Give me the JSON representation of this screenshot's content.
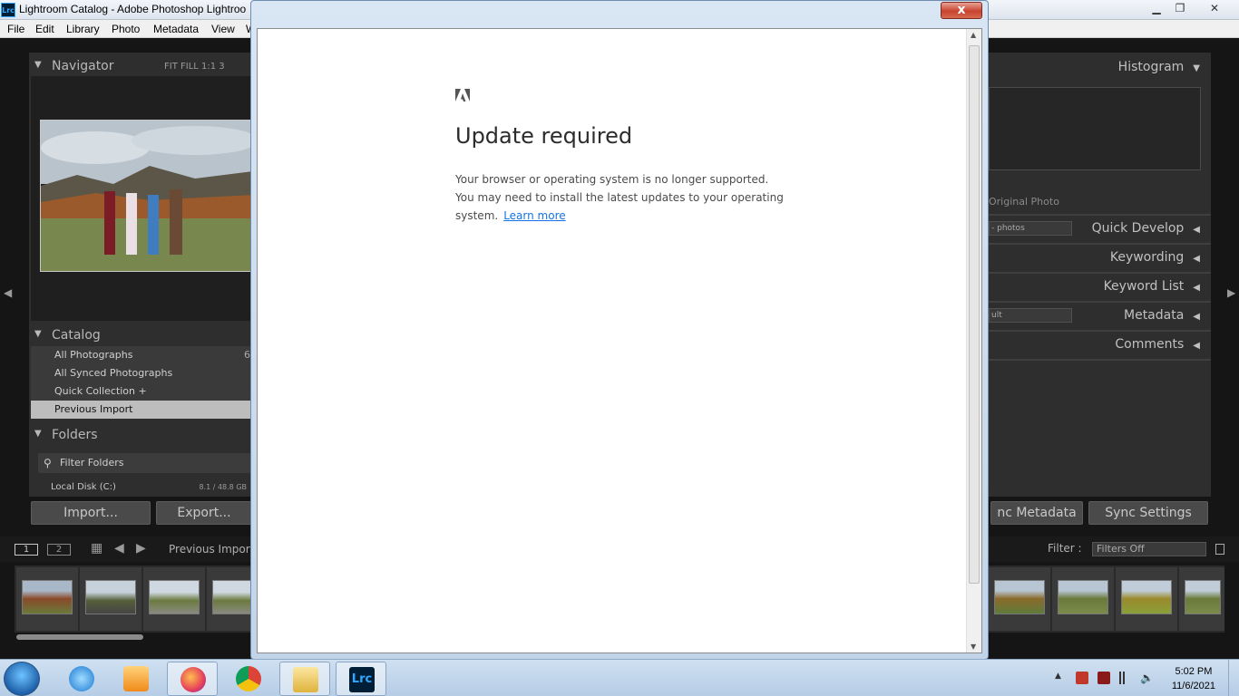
{
  "window": {
    "app_icon": "Lrc",
    "title": "Lightroom Catalog - Adobe Photoshop Lightroo",
    "minimize_icon": "minimize-icon",
    "maximize_icon": "maximize-icon",
    "close_icon": "close-icon"
  },
  "menu": [
    "File",
    "Edit",
    "Library",
    "Photo",
    "Metadata",
    "View",
    "W"
  ],
  "navigator": {
    "title": "Navigator",
    "modes": "FIT   FILL   1:1   3"
  },
  "catalog": {
    "title": "Catalog",
    "items": [
      {
        "label": "All Photographs",
        "count": "6",
        "selected": false
      },
      {
        "label": "All Synced Photographs",
        "count": "",
        "selected": false
      },
      {
        "label": "Quick Collection  +",
        "count": "",
        "selected": false
      },
      {
        "label": "Previous Import",
        "count": "",
        "selected": true
      }
    ]
  },
  "folders": {
    "title": "Folders",
    "filter_placeholder": "Filter Folders",
    "disk_label": "Local Disk (C:)",
    "disk_size": "8.1 / 48.8 GB"
  },
  "left_buttons": {
    "import": "Import...",
    "export": "Export..."
  },
  "right_panel": {
    "histogram": "Histogram",
    "original_photo": "Original Photo",
    "quick_develop_select": "- photos",
    "quick_develop": "Quick Develop",
    "keywording": "Keywording",
    "keyword_list": "Keyword List",
    "metadata_select": "ult",
    "metadata": "Metadata",
    "comments": "Comments",
    "sync_metadata": "nc Metadata",
    "sync_settings": "Sync Settings"
  },
  "toolbar": {
    "page1": "1",
    "page2": "2",
    "source": "Previous Import",
    "filter_label": "Filter :",
    "filter_value": "Filters Off"
  },
  "dialog": {
    "close_label": "x",
    "heading": "Update required",
    "line1": "Your browser or operating system is no longer supported.",
    "line2": "You may need to install the latest updates to your operating",
    "line3": "system.",
    "link": "Learn more"
  },
  "taskbar": {
    "apps": [
      "internet-explorer-icon",
      "media-player-icon",
      "firefox-icon",
      "chrome-icon",
      "file-explorer-icon",
      "lightroom-icon"
    ],
    "lightroom_label": "Lrc",
    "time": "5:02 PM",
    "date": "11/6/2021"
  },
  "colors": {
    "lr_background": "#151515",
    "panel": "#2e2e2e",
    "link": "#1473e6",
    "close_button": "#c7432e"
  }
}
